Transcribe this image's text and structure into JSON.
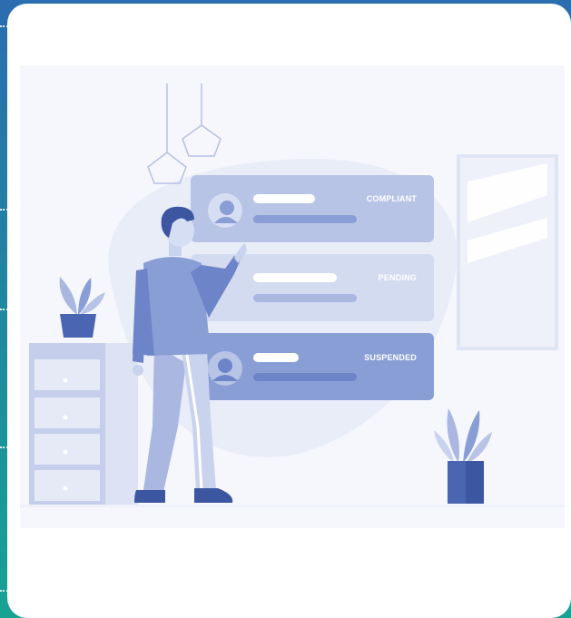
{
  "statuses": [
    {
      "label": "COMPLIANT"
    },
    {
      "label": "PENDING"
    },
    {
      "label": "SUSPENDED"
    }
  ],
  "colors": {
    "background_top": "#2a6db0",
    "background_bottom": "#17a394",
    "illustration_primary": "#4a66b3",
    "illustration_light": "#c9d3ee",
    "panel_compliant": "#b8c4e6",
    "panel_pending": "#d3dbf0",
    "panel_suspended": "#8a9ed6"
  },
  "icons": [
    "user-avatar-icon",
    "pendant-lamp-icon",
    "potted-plant-icon",
    "dresser-icon",
    "window-icon",
    "person-figure"
  ]
}
